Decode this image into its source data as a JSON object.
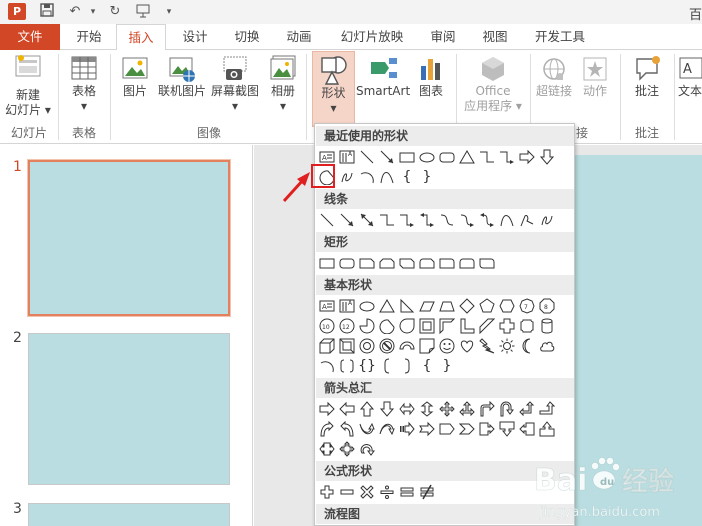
{
  "app": {
    "title_partial": "百"
  },
  "quick_access": [
    "save-icon",
    "undo-icon",
    "redo-icon",
    "start-presentation-icon",
    "customize-icon"
  ],
  "tabs": [
    {
      "label": "文件",
      "type": "file"
    },
    {
      "label": "开始"
    },
    {
      "label": "插入",
      "active": true
    },
    {
      "label": "设计"
    },
    {
      "label": "切换"
    },
    {
      "label": "动画"
    },
    {
      "label": "幻灯片放映"
    },
    {
      "label": "审阅"
    },
    {
      "label": "视图"
    },
    {
      "label": "开发工具"
    }
  ],
  "ribbon": {
    "new_slide": {
      "line1": "新建",
      "line2": "幻灯片 ▾"
    },
    "table": {
      "label": "表格",
      "caret": "▾"
    },
    "picture": {
      "label": "图片"
    },
    "online_picture": {
      "label": "联机图片"
    },
    "screenshot": {
      "label": "屏幕截图",
      "caret": "▾"
    },
    "album": {
      "label": "相册",
      "caret": "▾"
    },
    "shapes": {
      "label": "形状",
      "caret": "▾"
    },
    "smartart": {
      "label": "SmartArt"
    },
    "chart": {
      "label": "图表"
    },
    "office_apps": {
      "line1": "Office",
      "line2": "应用程序 ▾"
    },
    "hyperlink": {
      "label": "超链接"
    },
    "action": {
      "label": "动作"
    },
    "comment": {
      "label": "批注"
    },
    "text": {
      "label": "文本"
    },
    "groups": {
      "slides": "幻灯片",
      "tables": "表格",
      "images": "图像",
      "links_partial": "接",
      "comments": "批注"
    }
  },
  "slides": {
    "numbers": [
      "1",
      "2",
      "3"
    ],
    "thumb_color": "#b9dde0"
  },
  "shapes_menu": {
    "sections": {
      "recent": "最近使用的形状",
      "lines": "线条",
      "rect": "矩形",
      "basic": "基本形状",
      "arrows": "箭头总汇",
      "equation": "公式形状",
      "flowchart": "流程图"
    },
    "highlighted_shape": "chord-shape"
  },
  "watermark": {
    "brand": "Bai",
    "brand2": "经验",
    "url": "jingyan.baidu.com"
  },
  "colors": {
    "accent": "#d24726",
    "selected_tab_bg": "#f6d5c9",
    "highlight": "#e02020"
  }
}
